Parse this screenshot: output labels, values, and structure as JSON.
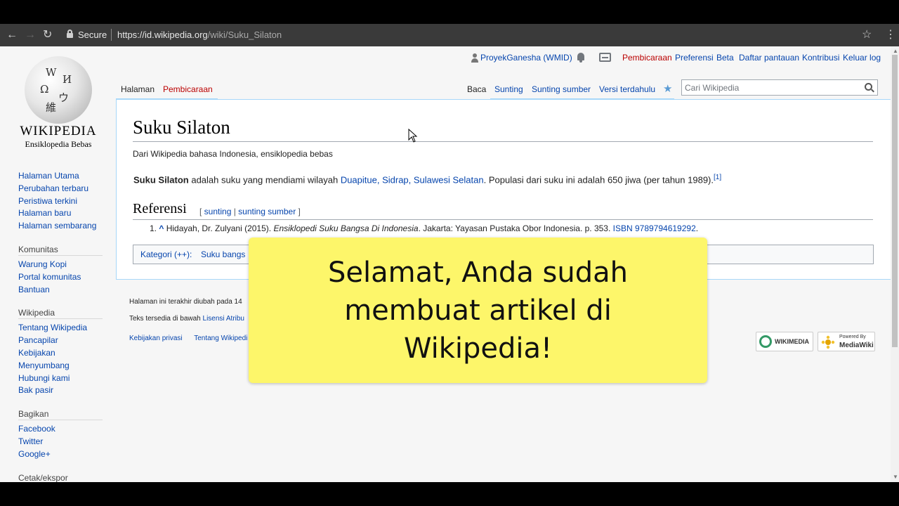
{
  "browser": {
    "secure_label": "Secure",
    "url_host": "https://id.wikipedia.org",
    "url_path": "/wiki/Suku_Silaton"
  },
  "logo": {
    "wordmark": "WIKIPEDIA",
    "tagline": "Ensiklopedia Bebas"
  },
  "sidebar": {
    "main": [
      "Halaman Utama",
      "Perubahan terbaru",
      "Peristiwa terkini",
      "Halaman baru",
      "Halaman sembarang"
    ],
    "komunitas_title": "Komunitas",
    "komunitas": [
      "Warung Kopi",
      "Portal komunitas",
      "Bantuan"
    ],
    "wikipedia_title": "Wikipedia",
    "wikipedia": [
      "Tentang Wikipedia",
      "Pancapilar",
      "Kebijakan",
      "Menyumbang",
      "Hubungi kami",
      "Bak pasir"
    ],
    "bagikan_title": "Bagikan",
    "bagikan": [
      "Facebook",
      "Twitter",
      "Google+"
    ],
    "cetak_title": "Cetak/ekspor"
  },
  "personal": {
    "user": "ProyekGanesha (WMID)",
    "talk": "Pembicaraan",
    "prefs": "Preferensi",
    "beta": "Beta",
    "watchlist": "Daftar pantauan",
    "contribs": "Kontribusi",
    "logout": "Keluar log"
  },
  "tabs": {
    "page": "Halaman",
    "talk": "Pembicaraan",
    "read": "Baca",
    "edit": "Sunting",
    "edit_source": "Sunting sumber",
    "history": "Versi terdahulu"
  },
  "search": {
    "placeholder": "Cari Wikipedia"
  },
  "article": {
    "title": "Suku Silaton",
    "site_sub": "Dari Wikipedia bahasa Indonesia, ensiklopedia bebas",
    "bold_term": "Suku Silaton",
    "text1": " adalah suku yang mendiami wilayah ",
    "link_place": "Duapitue, Sidrap, Sulawesi Selatan",
    "text2": ". Populasi dari suku ini adalah 650 jiwa (per tahun 1989).",
    "ref_marker": "[1]",
    "ref_heading": "Referensi",
    "edit_open": "[ ",
    "edit_link": "sunting",
    "edit_sep": " | ",
    "edit_source_link": "sunting sumber",
    "edit_close": " ]",
    "ref_number": "1. ",
    "ref_caret": "^",
    "ref_author": " Hidayah, Dr. Zulyani (2015). ",
    "ref_book": "Ensiklopedi Suku Bangsa Di Indonesia",
    "ref_pub": ". Jakarta: Yayasan Pustaka Obor Indonesia. p. 353. ",
    "ref_isbn": "ISBN 9789794619292",
    "ref_end": ".",
    "category_label": "Kategori (++):",
    "category_item": "Suku bangs"
  },
  "footer": {
    "last_modified": "Halaman ini terakhir diubah pada 14",
    "license_prefix": "Teks tersedia di bawah ",
    "license_link": "Lisensi Atribu",
    "privacy": "Kebijakan privasi",
    "about": "Tentang Wikipedi",
    "wikimedia_badge": "WIKIMEDIA",
    "mediawiki_top": "Powered By",
    "mediawiki_bottom": "MediaWiki"
  },
  "overlay": {
    "message": "Selamat, Anda sudah membuat artikel di Wikipedia!"
  }
}
